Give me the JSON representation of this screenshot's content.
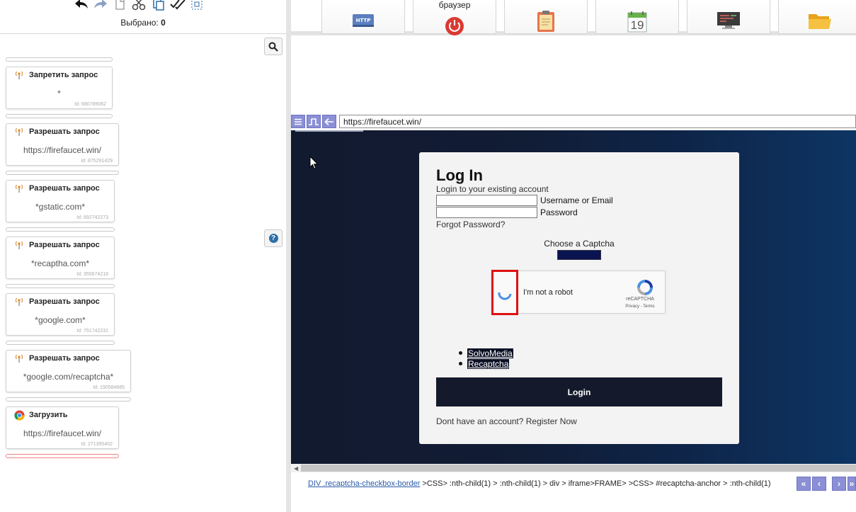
{
  "toolbar": {
    "icons": [
      "undo-icon",
      "redo-icon",
      "copy-icon",
      "cut-icon",
      "paste-icon",
      "select-all-icon",
      "select-frame-icon"
    ],
    "selected_label": "Выбрано:",
    "selected_count": "0"
  },
  "blocks": [
    {
      "title": "Запретить запрос",
      "value": "*",
      "id": "Id: 680789062",
      "icon": "signal-icon"
    },
    {
      "title": "Разрешать запрос",
      "value": "https://firefaucet.win/",
      "id": "Id: 875291429",
      "icon": "signal-icon"
    },
    {
      "title": "Разрешать запрос",
      "value": "*gstatic.com*",
      "id": "Id: 892742273",
      "icon": "signal-icon"
    },
    {
      "title": "Разрешать запрос",
      "value": "*recaptha.com*",
      "id": "Id: 355674218",
      "icon": "signal-icon"
    },
    {
      "title": "Разрешать запрос",
      "value": "*google.com*",
      "id": "Id: 751742231",
      "icon": "signal-icon"
    },
    {
      "title": "Разрешать запрос",
      "value": "*google.com/recaptcha*",
      "id": "Id: 190584685",
      "icon": "signal-icon"
    },
    {
      "title": "Загрузить",
      "value": "https://firefaucet.win/",
      "id": "Id: 271395402",
      "icon": "chrome-icon"
    }
  ],
  "tiles": [
    {
      "label": "",
      "icon": "http-icon"
    },
    {
      "label": "браузер",
      "icon": "power-icon"
    },
    {
      "label": "",
      "icon": "clipboard-icon"
    },
    {
      "label": "",
      "icon": "calendar-icon",
      "day": "19"
    },
    {
      "label": "",
      "icon": "monitor-icon"
    },
    {
      "label": "",
      "icon": "folder-icon"
    }
  ],
  "browser": {
    "url": "https://firefaucet.win/"
  },
  "login": {
    "title": "Log In",
    "subtitle": "Login to your existing account",
    "username_label": "Username or Email",
    "password_label": "Password",
    "forgot": "Forgot Password?",
    "choose_captcha": "Choose a Captcha",
    "recaptcha_label": "I'm not a robot",
    "recaptcha_brand": "reCAPTCHA",
    "recaptcha_links": "Privacy - Terms",
    "captcha_options": [
      "SolvoMedia",
      "Recaptcha"
    ],
    "login_button": "Login",
    "register": "Dont have an account? Register Now"
  },
  "path": {
    "link": "DIV .recaptcha-checkbox-border",
    "rest": " >CSS> :nth-child(1) > :nth-child(1) > div > iframe>FRAME>  >CSS> #recaptcha-anchor > :nth-child(1)"
  },
  "colors": {
    "accent": "#8b8fd6",
    "highlight": "#e01010",
    "login_bg": "#141a2b"
  }
}
